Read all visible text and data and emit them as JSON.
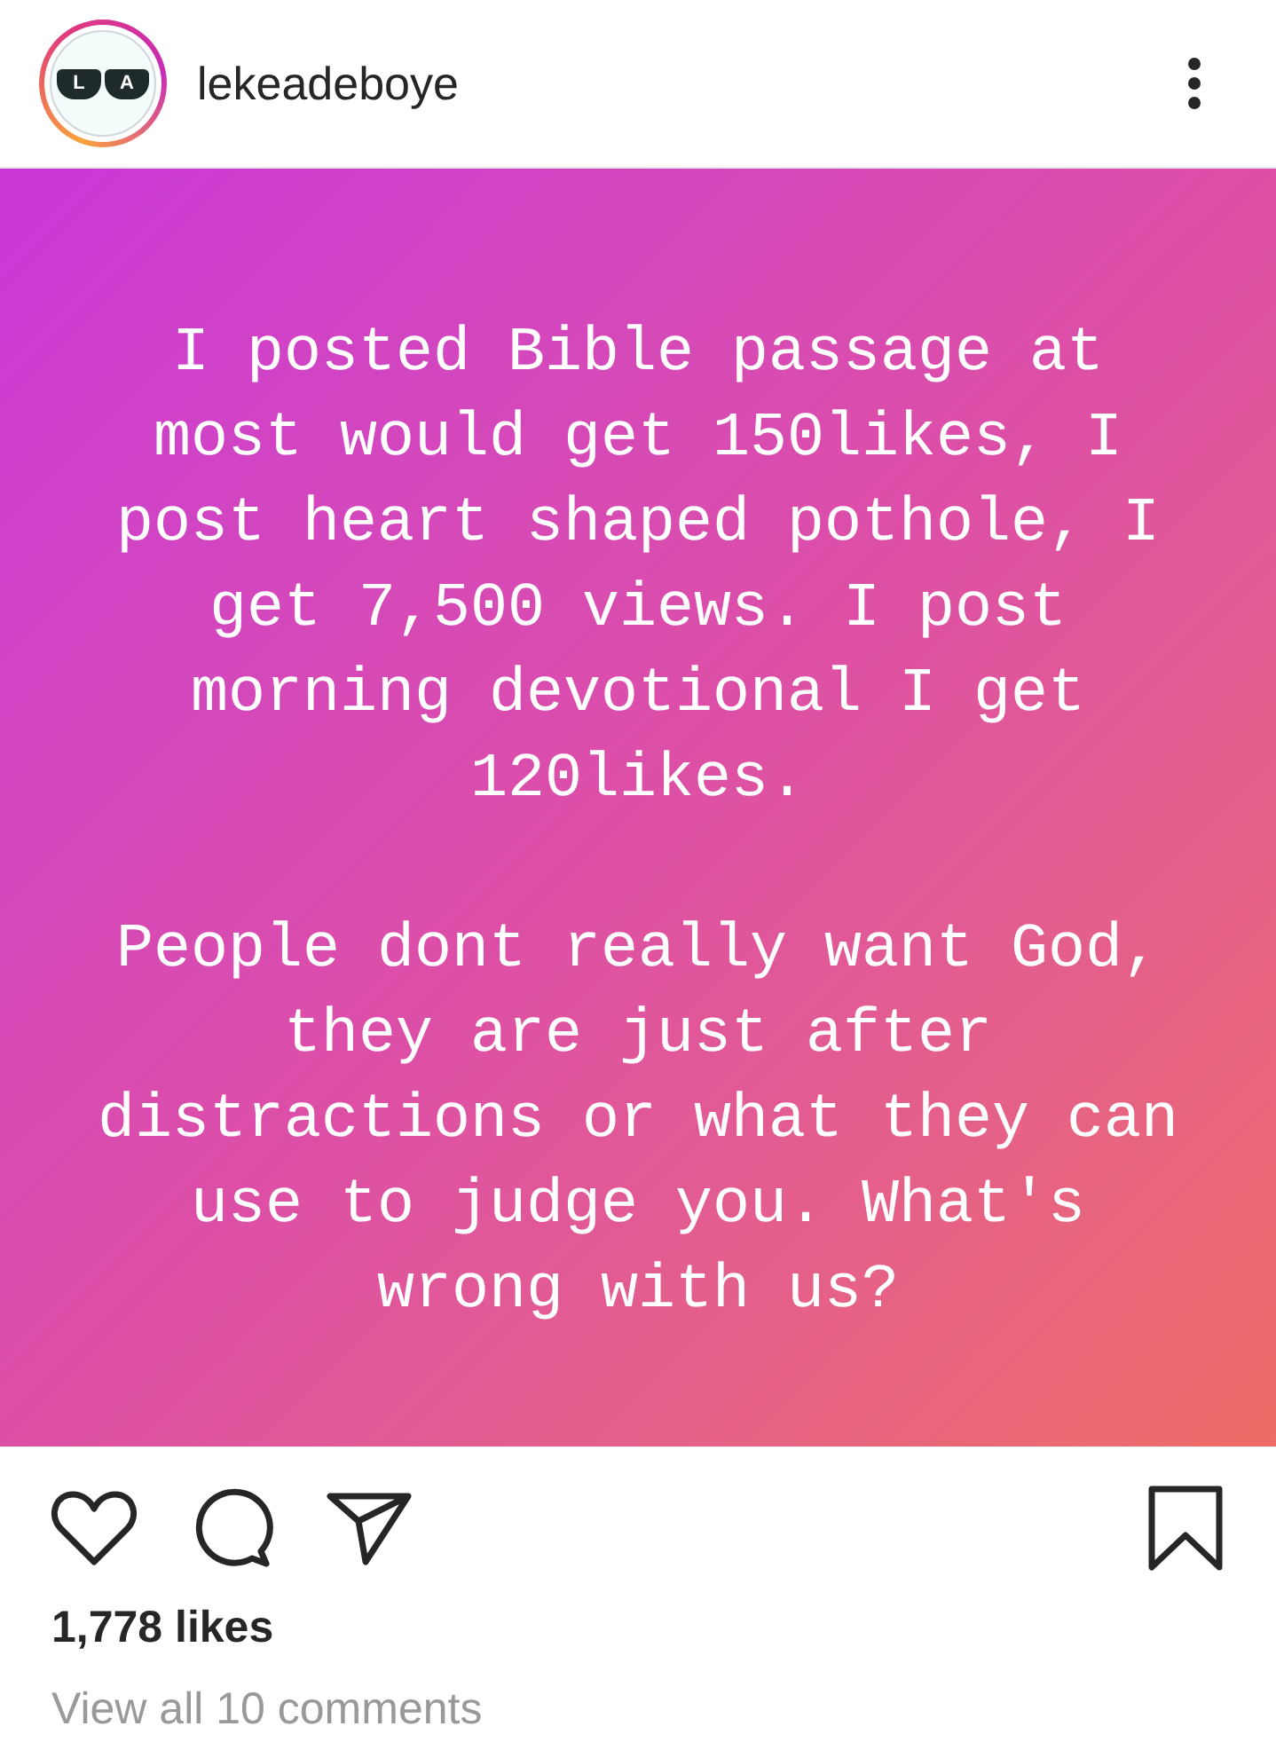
{
  "header": {
    "avatar_letters": [
      "L",
      "A"
    ],
    "username": "lekeadeboye"
  },
  "post": {
    "paragraphs": [
      {
        "lines": [
          "I posted Bible passage at",
          "most would get 150likes, I",
          "post heart shaped pothole, I",
          "get 7,500 views. I post",
          "morning devotional I get",
          "120likes."
        ]
      },
      {
        "lines": [
          "People dont really want God,",
          "they are just after",
          "distractions or what they can",
          "use to judge you. What's",
          "wrong with us?"
        ]
      }
    ]
  },
  "likes": "1,778 likes",
  "comments_link": "View all 10 comments"
}
